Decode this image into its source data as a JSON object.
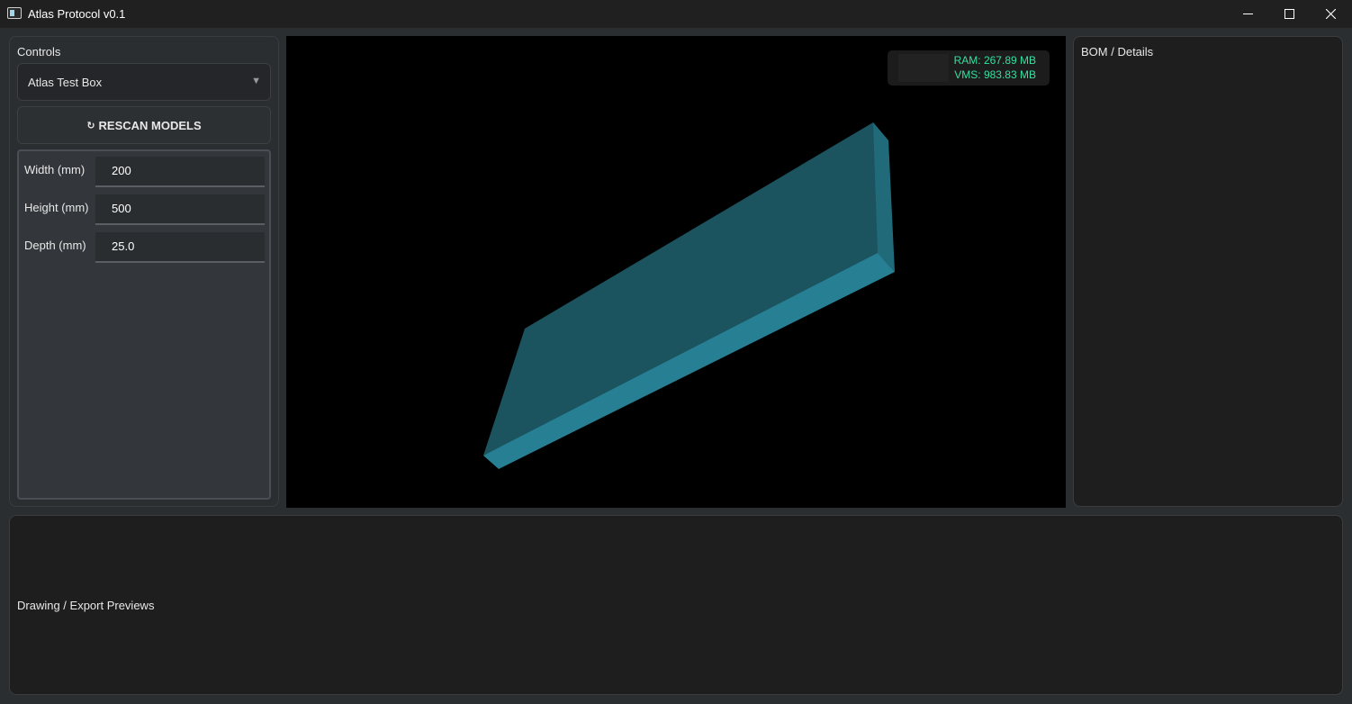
{
  "window": {
    "title": "Atlas Protocol v0.1",
    "minimize_icon": "minimize-icon",
    "maximize_icon": "maximize-icon",
    "close_icon": "close-icon"
  },
  "controls": {
    "label": "Controls",
    "model_select": {
      "value": "Atlas Test Box",
      "arrow_icon": "triangle-down-icon"
    },
    "rescan_button": {
      "glyph": "↻",
      "label": "RESCAN MODELS"
    },
    "params": [
      {
        "label": "Width (mm)",
        "value": "200"
      },
      {
        "label": "Height (mm)",
        "value": "500"
      },
      {
        "label": "Depth (mm)",
        "value": "25.0"
      }
    ]
  },
  "viewport": {
    "ram": "RAM: 267.89 MB",
    "vms": "VMS: 983.83 MB",
    "box_colors": {
      "top_face": "#1b535f",
      "side_face": "#267f93",
      "end_face": "#216a7a"
    }
  },
  "bom": {
    "label": "BOM / Details"
  },
  "previews": {
    "label": "Drawing / Export Previews"
  }
}
